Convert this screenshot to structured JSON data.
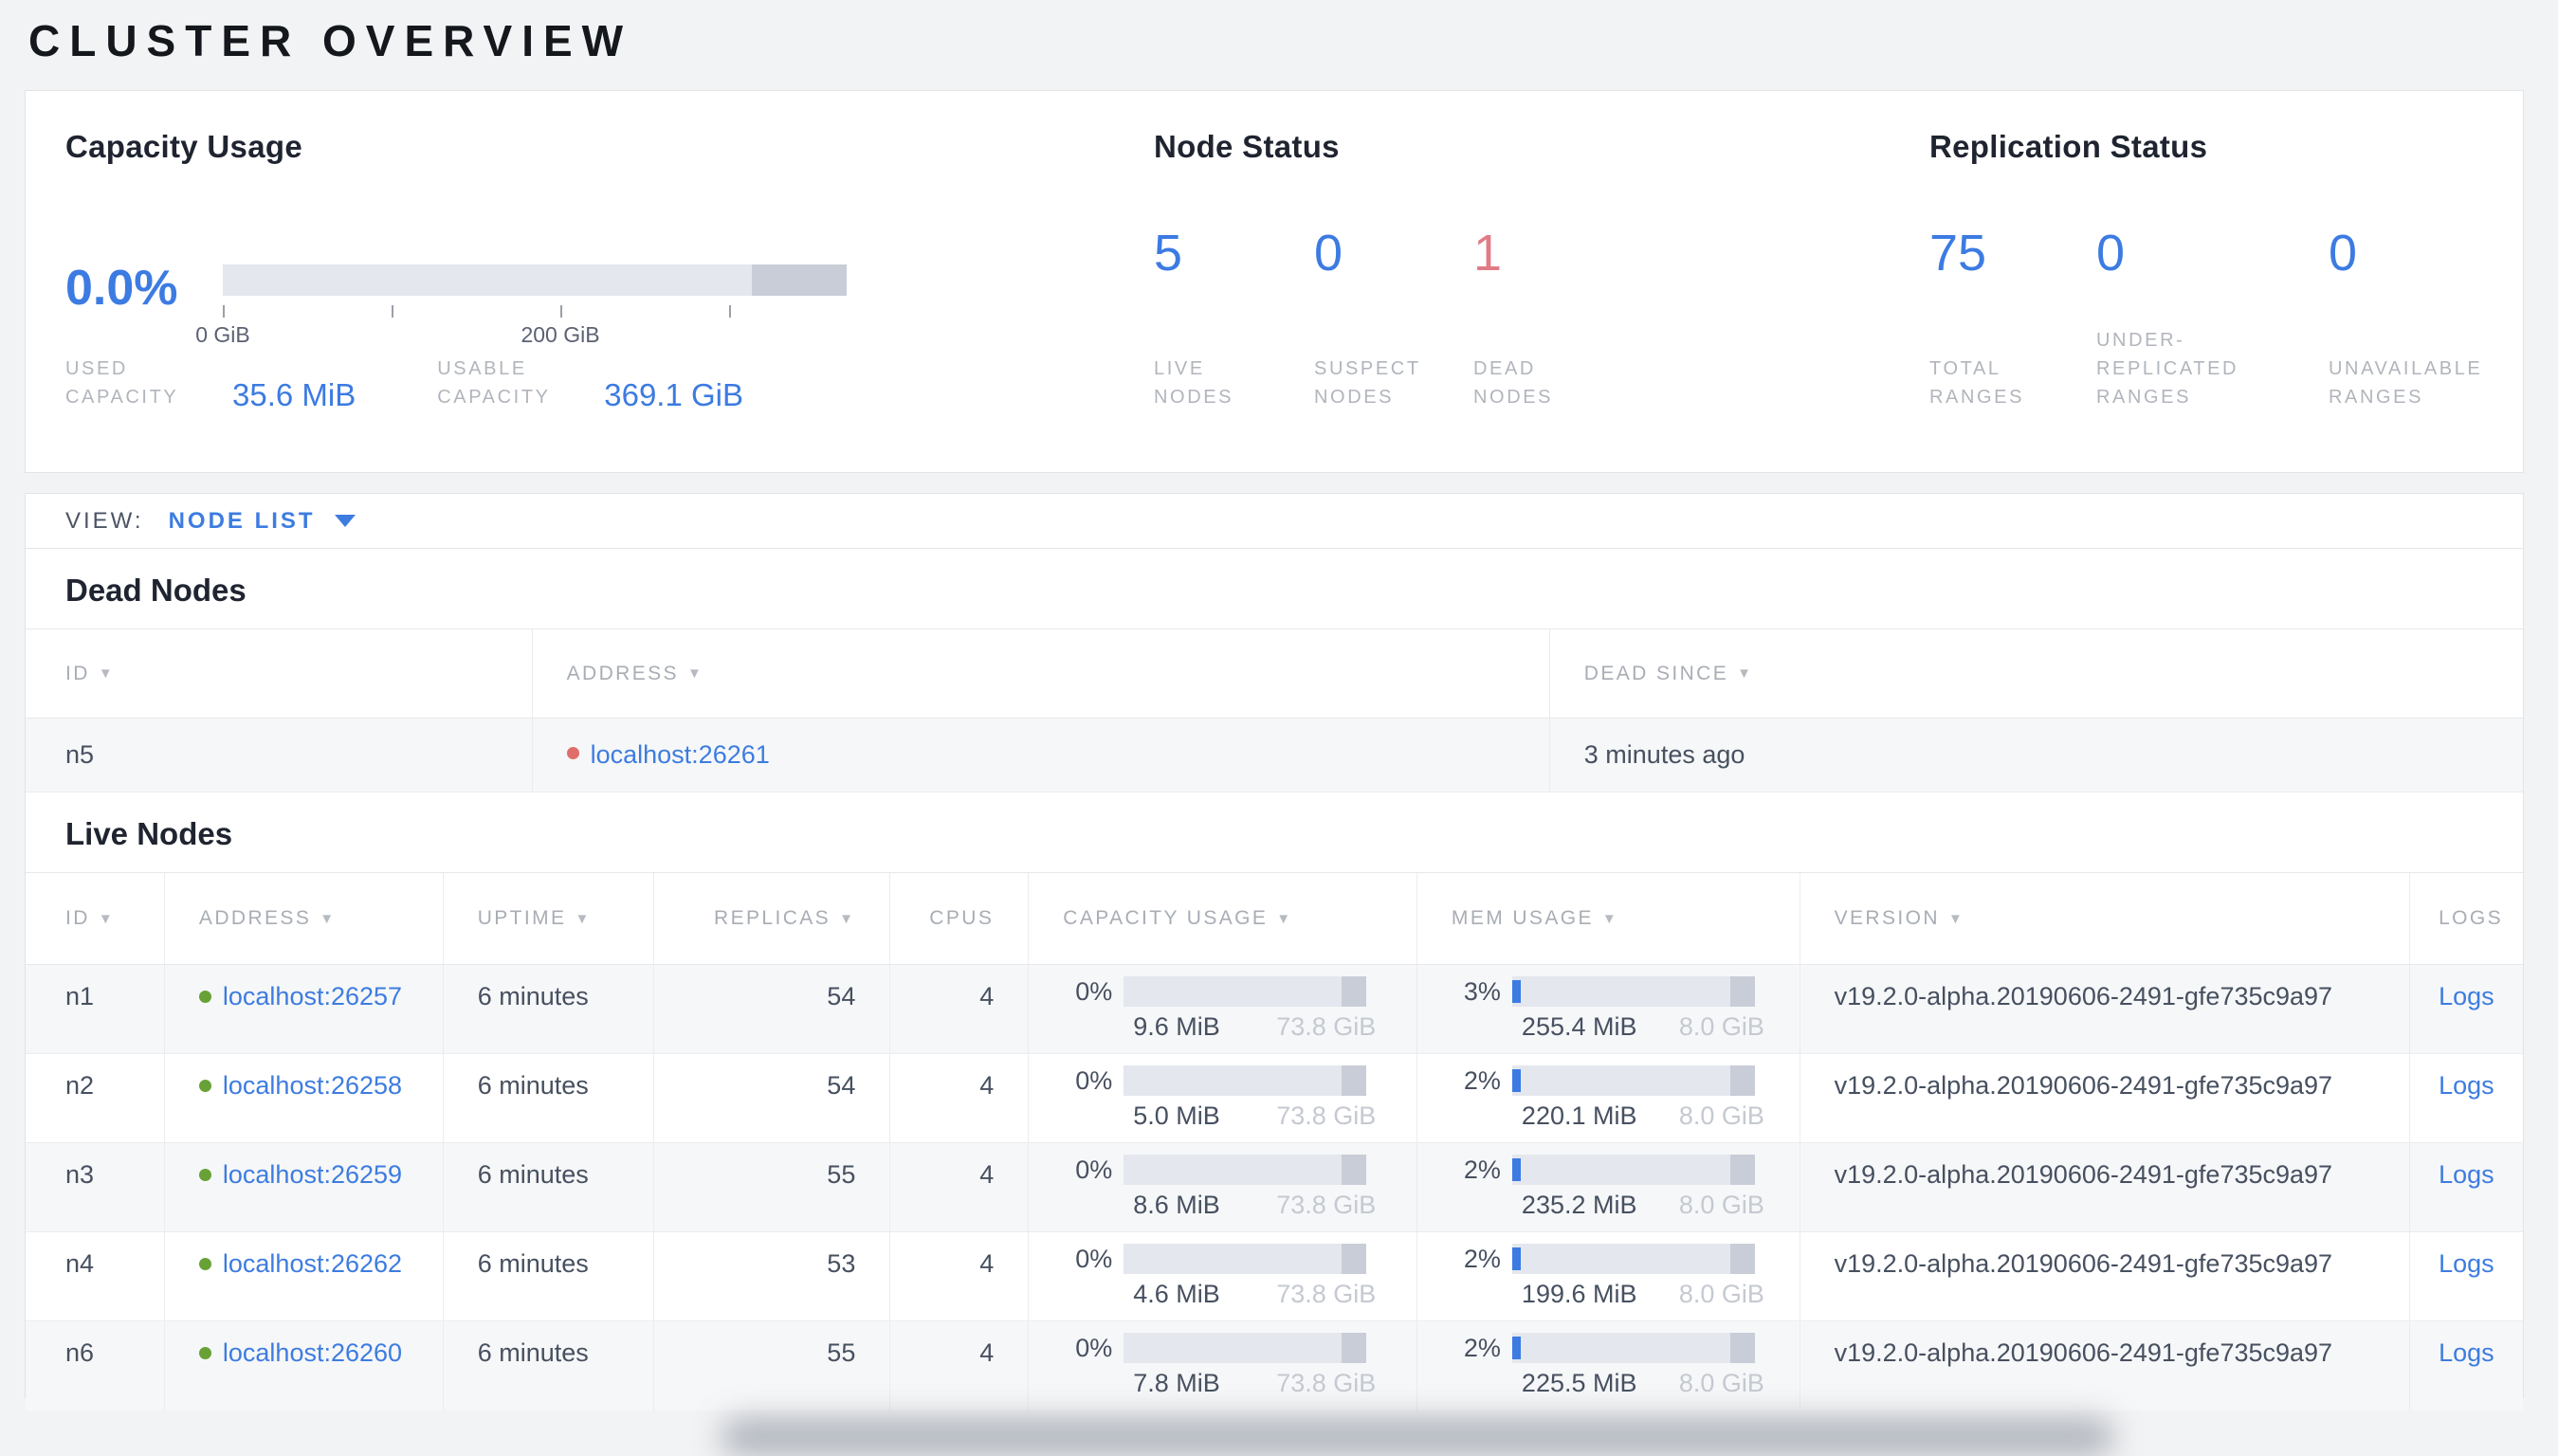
{
  "page": {
    "title": "CLUSTER OVERVIEW"
  },
  "colors": {
    "accent_blue": "#3c7be2",
    "dead_red": "#e17b87",
    "live_dot_green": "#68a135",
    "dead_dot_red": "#df6e6a",
    "bar_track": "#e4e7ee",
    "bar_dark_segment": "#c9cdd7"
  },
  "summary": {
    "capacity": {
      "title": "Capacity Usage",
      "percent": "0.0%",
      "axis_tick_0": "0 GiB",
      "axis_tick_200": "200 GiB",
      "used_label": "USED CAPACITY",
      "used_value": "35.6 MiB",
      "usable_label": "USABLE CAPACITY",
      "usable_value": "369.1 GiB"
    },
    "node_status": {
      "title": "Node Status",
      "metrics": [
        {
          "value": "5",
          "label": "LIVE NODES"
        },
        {
          "value": "0",
          "label": "SUSPECT NODES"
        },
        {
          "value": "1",
          "label": "DEAD NODES"
        }
      ]
    },
    "replication": {
      "title": "Replication Status",
      "metrics": [
        {
          "value": "75",
          "label": "TOTAL RANGES"
        },
        {
          "value": "0",
          "label": "UNDER-REPLICATED RANGES"
        },
        {
          "value": "0",
          "label": "UNAVAILABLE RANGES"
        }
      ]
    }
  },
  "view_bar": {
    "label": "VIEW:",
    "selected": "NODE LIST"
  },
  "dead_nodes": {
    "title": "Dead Nodes",
    "columns": [
      "ID",
      "ADDRESS",
      "DEAD SINCE"
    ],
    "rows": [
      {
        "id": "n5",
        "address": "localhost:26261",
        "dead_since": "3 minutes ago"
      }
    ]
  },
  "live_nodes": {
    "title": "Live Nodes",
    "columns": [
      "ID",
      "ADDRESS",
      "UPTIME",
      "REPLICAS",
      "CPUS",
      "CAPACITY USAGE",
      "MEM USAGE",
      "VERSION",
      "LOGS"
    ],
    "logs_link_label": "Logs",
    "rows": [
      {
        "id": "n1",
        "address": "localhost:26257",
        "uptime": "6 minutes",
        "replicas": "54",
        "cpus": "4",
        "capacity_pct": "0%",
        "capacity_used": "9.6 MiB",
        "capacity_total": "73.8 GiB",
        "mem_pct": "3%",
        "mem_used": "255.4 MiB",
        "mem_total": "8.0 GiB",
        "version": "v19.2.0-alpha.20190606-2491-gfe735c9a97",
        "logs": "Logs"
      },
      {
        "id": "n2",
        "address": "localhost:26258",
        "uptime": "6 minutes",
        "replicas": "54",
        "cpus": "4",
        "capacity_pct": "0%",
        "capacity_used": "5.0 MiB",
        "capacity_total": "73.8 GiB",
        "mem_pct": "2%",
        "mem_used": "220.1 MiB",
        "mem_total": "8.0 GiB",
        "version": "v19.2.0-alpha.20190606-2491-gfe735c9a97",
        "logs": "Logs"
      },
      {
        "id": "n3",
        "address": "localhost:26259",
        "uptime": "6 minutes",
        "replicas": "55",
        "cpus": "4",
        "capacity_pct": "0%",
        "capacity_used": "8.6 MiB",
        "capacity_total": "73.8 GiB",
        "mem_pct": "2%",
        "mem_used": "235.2 MiB",
        "mem_total": "8.0 GiB",
        "version": "v19.2.0-alpha.20190606-2491-gfe735c9a97",
        "logs": "Logs"
      },
      {
        "id": "n4",
        "address": "localhost:26262",
        "uptime": "6 minutes",
        "replicas": "53",
        "cpus": "4",
        "capacity_pct": "0%",
        "capacity_used": "4.6 MiB",
        "capacity_total": "73.8 GiB",
        "mem_pct": "2%",
        "mem_used": "199.6 MiB",
        "mem_total": "8.0 GiB",
        "version": "v19.2.0-alpha.20190606-2491-gfe735c9a97",
        "logs": "Logs"
      },
      {
        "id": "n6",
        "address": "localhost:26260",
        "uptime": "6 minutes",
        "replicas": "55",
        "cpus": "4",
        "capacity_pct": "0%",
        "capacity_used": "7.8 MiB",
        "capacity_total": "73.8 GiB",
        "mem_pct": "2%",
        "mem_used": "225.5 MiB",
        "mem_total": "8.0 GiB",
        "version": "v19.2.0-alpha.20190606-2491-gfe735c9a97",
        "logs": "Logs"
      }
    ]
  }
}
